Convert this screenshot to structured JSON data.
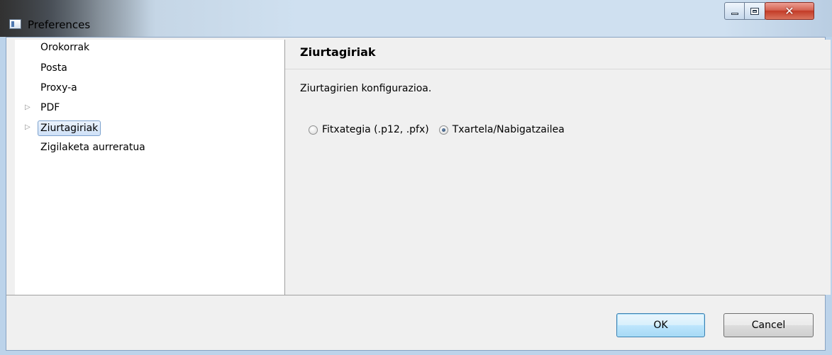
{
  "window": {
    "title": "Preferences"
  },
  "sidebar": {
    "items": [
      {
        "label": "Orokorrak",
        "expandable": false,
        "selected": false
      },
      {
        "label": "Posta",
        "expandable": false,
        "selected": false
      },
      {
        "label": "Proxy-a",
        "expandable": false,
        "selected": false
      },
      {
        "label": "PDF",
        "expandable": true,
        "selected": false
      },
      {
        "label": "Ziurtagiriak",
        "expandable": true,
        "selected": true
      },
      {
        "label": "Zigilaketa aurreratua",
        "expandable": false,
        "selected": false
      }
    ]
  },
  "panel": {
    "title": "Ziurtagiriak",
    "description": "Ziurtagirien konfigurazioa.",
    "options": [
      {
        "label": "Fitxategia (.p12, .pfx)",
        "checked": false
      },
      {
        "label": "Txartela/Nabigatzailea",
        "checked": true
      }
    ]
  },
  "buttons": {
    "ok": "OK",
    "cancel": "Cancel"
  },
  "icons": {
    "tree_expand": "triangle-right-icon",
    "app": "window-app-icon"
  }
}
